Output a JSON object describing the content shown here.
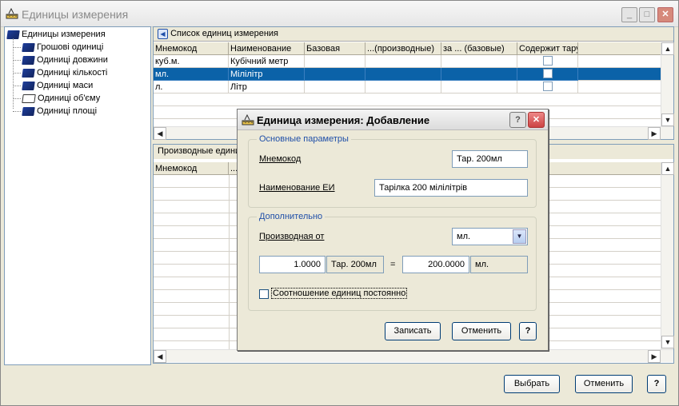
{
  "window": {
    "title": "Единицы измерения"
  },
  "tree": {
    "root": "Единицы измерения",
    "items": [
      "Грошові одиниці",
      "Одиниці довжини",
      "Одиниці кількості",
      "Одиниці маси",
      "Одиниці об'єму",
      "Одиниці площі"
    ]
  },
  "units_panel": {
    "title": "Список единиц измерения",
    "columns": [
      "Мнемокод",
      "Наименование",
      "Базовая",
      "...(производные)",
      "за ... (базовые)",
      "Содержит тару"
    ],
    "rows": [
      {
        "code": "куб.м.",
        "name": "Кубічний метр",
        "selected": false
      },
      {
        "code": "мл.",
        "name": "Мілілітр",
        "selected": true
      },
      {
        "code": "л.",
        "name": "Літр",
        "selected": false
      }
    ]
  },
  "derived_panel": {
    "title": "Производные едини",
    "columns": [
      "Мнемокод",
      "..."
    ]
  },
  "dialog": {
    "title": "Единица измерения: Добавление",
    "basic_group": "Основные параметры",
    "mnemocode_label": "Мнемокод",
    "mnemocode_value": "Тар. 200мл",
    "name_label": "Наименование ЕИ",
    "name_value": "Тарілка 200 мілілітрів",
    "extra_group": "Дополнительно",
    "derived_label": "Производная от",
    "derived_value": "мл.",
    "ratio_left": "1.0000",
    "ratio_left_unit": "Тар. 200мл",
    "equals": "=",
    "ratio_right": "200.0000",
    "ratio_right_unit": "мл.",
    "constant_label": "Соотношение единиц постоянно",
    "save": "Записать",
    "cancel": "Отменить",
    "help": "?"
  },
  "footer": {
    "select": "Выбрать",
    "cancel": "Отменить",
    "help": "?"
  },
  "colors": {
    "selection": "#0b62a8",
    "accent": "#1f4fa8"
  }
}
